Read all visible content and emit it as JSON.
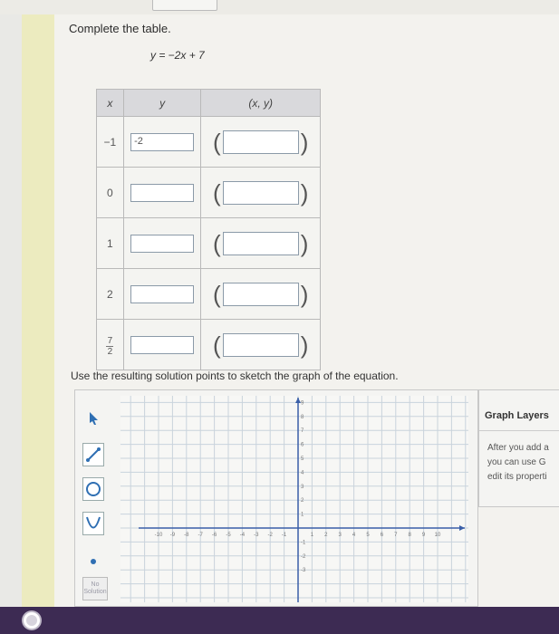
{
  "header": {
    "prompt": "Complete the table.",
    "equation": "y = −2x + 7"
  },
  "table": {
    "headers": {
      "x": "x",
      "y": "y",
      "xy": "(x, y)"
    },
    "rows": [
      {
        "x": "−1",
        "y_value": "-2"
      },
      {
        "x": "0",
        "y_value": ""
      },
      {
        "x": "1",
        "y_value": ""
      },
      {
        "x": "2",
        "y_value": ""
      },
      {
        "x_num": "7",
        "x_den": "2",
        "y_value": ""
      }
    ]
  },
  "instruction": "Use the resulting solution points to sketch the graph of the equation.",
  "tools": [
    "pointer-icon",
    "line-tool-icon",
    "circle-tool-icon",
    "parabola-tool-icon",
    "point-tool-icon"
  ],
  "no_solution": {
    "line1": "No",
    "line2": "Solution"
  },
  "graph": {
    "x_ticks": [
      "-10",
      "-9",
      "-8",
      "-7",
      "-6",
      "-5",
      "-4",
      "-3",
      "-2",
      "-1",
      "1",
      "2",
      "3",
      "4",
      "5",
      "6",
      "7",
      "8",
      "9",
      "10"
    ],
    "y_ticks": [
      "10",
      "9",
      "8",
      "7",
      "6",
      "5",
      "4",
      "3",
      "2",
      "1",
      "-1",
      "-2",
      "-3"
    ]
  },
  "layers": {
    "title": "Graph Layers",
    "line1": "After you add a",
    "line2": "you can use G",
    "line3": "edit its properti"
  },
  "colors": {
    "accent": "#3d2b53",
    "strip": "#ecebbf",
    "box_border": "#8b9aa8"
  }
}
